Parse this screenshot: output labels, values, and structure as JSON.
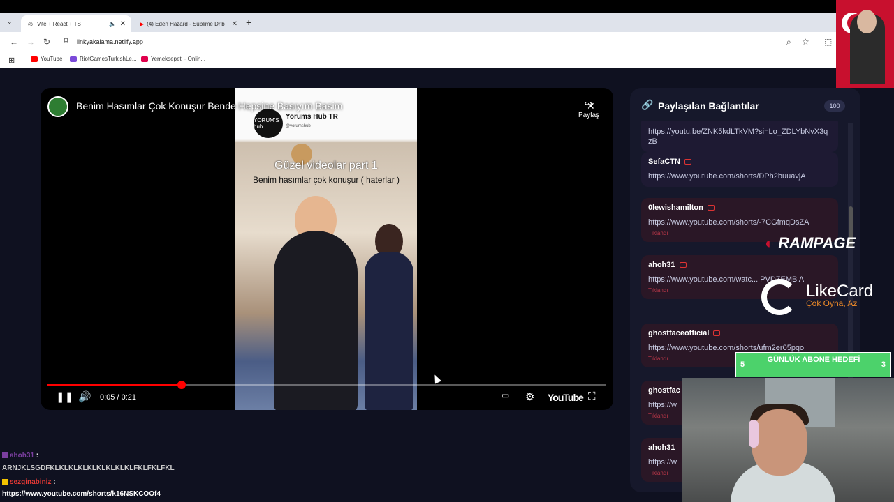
{
  "browser": {
    "tabs": [
      {
        "label": "Vite + React + TS",
        "active": true
      },
      {
        "label": "(4) Eden Hazard - Sublime Drib",
        "active": false
      }
    ],
    "url": "linkyakalama.netlify.app",
    "bookmarks": [
      {
        "label": "YouTube",
        "color": "#ff0000"
      },
      {
        "label": "RiotGamesTurkishLe...",
        "color": "#7b4ad9"
      },
      {
        "label": "Yemeksepeti - Onlin...",
        "color": "#e0004d"
      }
    ]
  },
  "video": {
    "title": "Benim Hasımlar Çok Konuşur Bende Hepsine Basıyım Basim",
    "share_label": "Paylaş",
    "channel_name": "Yorums Hub TR",
    "channel_handle": "@yorumshub",
    "channel_logo_text": "YORUM'S hub",
    "overlay_line1": "Güzel videolar part 1",
    "overlay_line2": "Benim hasımlar çok konuşur ( haterlar )",
    "time": "0:05 / 0:21",
    "progress": 0.24,
    "youtube_label": "YouTube"
  },
  "panel": {
    "title": "Paylaşılan Bağlantılar",
    "count": "100",
    "items": [
      {
        "user": "",
        "link": "https://youtu.be/ZNK5kdLTkVM?si=Lo_ZDLYbNvX3qzB",
        "status": ""
      },
      {
        "user": "SefaCTN",
        "link": "https://www.youtube.com/shorts/DPh2buuavjA",
        "status": ""
      },
      {
        "user": "0lewishamilton",
        "link": "https://www.youtube.com/shorts/-7CGfmqDsZA",
        "status": "Tıklandı"
      },
      {
        "user": "ahoh31",
        "link": "https://www.youtube.com/watc... PVDZEMB A",
        "status": "Tıklandı"
      },
      {
        "user": "ghostfaceofficial",
        "link": "https://www.youtube.com/shorts/ufm2er05pqo",
        "status": "Tıklandı"
      },
      {
        "user": "ghostfac",
        "link": "https://w",
        "status": "Tıklandı"
      },
      {
        "user": "ahoh31",
        "link": "https://w",
        "status": "Tıklandı"
      }
    ]
  },
  "overlays": {
    "rampage": "RAMPAGE",
    "likecard_name": "LikeCard",
    "likecard_tag": "Çok Oyna, Az",
    "goal_title": "GÜNLÜK ABONE HEDEFİ",
    "goal_min": "5",
    "goal_max": "3"
  },
  "chat": [
    {
      "user": "ahoh31",
      "sep": ":",
      "user_color": "#7b3fa0"
    },
    {
      "text": "ARNJKLSGDFKLKLKLKLKLKLKLKLKLFKLFKLFKL"
    },
    {
      "user": "sezginabiniz",
      "sep": ":",
      "user_color": "#e53935"
    },
    {
      "text": "https://www.youtube.com/shorts/k16NSKCOOf4"
    }
  ]
}
